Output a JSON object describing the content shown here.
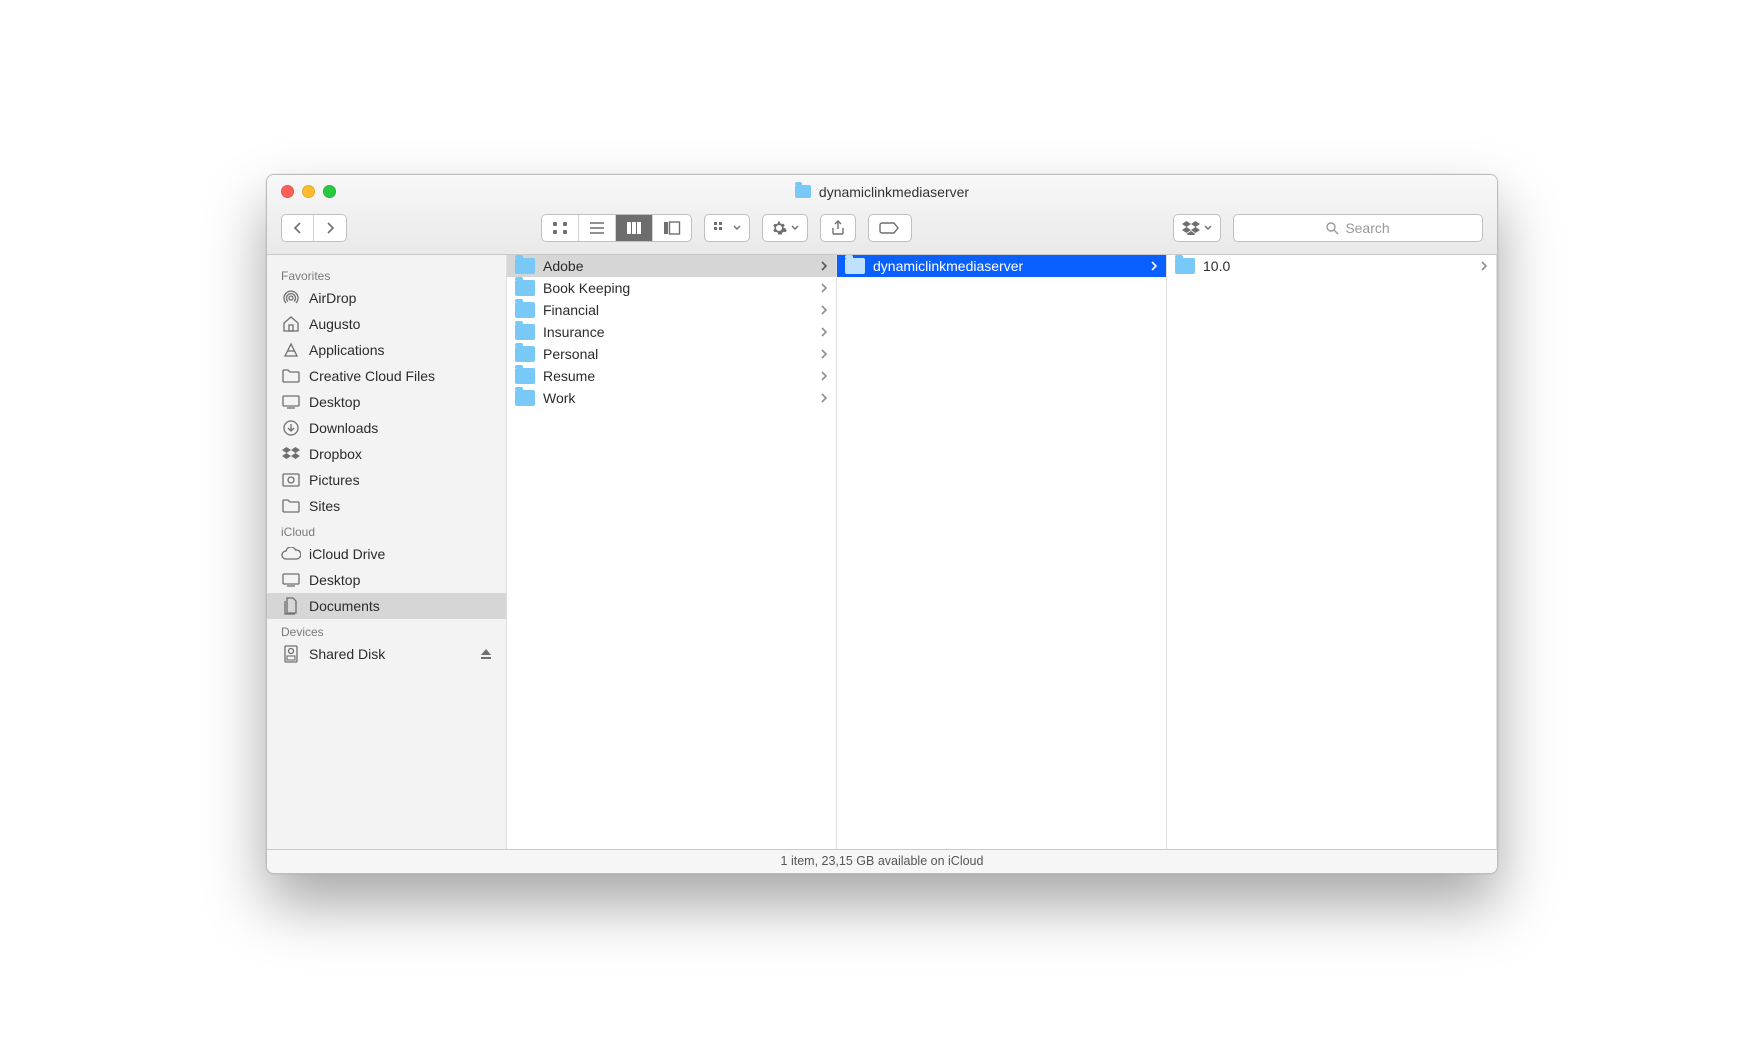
{
  "window_title": "dynamiclinkmediaserver",
  "search_placeholder": "Search",
  "status_bar": "1 item, 23,15 GB available on iCloud",
  "sidebar": {
    "groups": [
      {
        "title": "Favorites",
        "items": [
          {
            "icon": "airdrop",
            "label": "AirDrop"
          },
          {
            "icon": "home",
            "label": "Augusto"
          },
          {
            "icon": "app",
            "label": "Applications"
          },
          {
            "icon": "folder",
            "label": "Creative Cloud Files"
          },
          {
            "icon": "desktop",
            "label": "Desktop"
          },
          {
            "icon": "downloads",
            "label": "Downloads"
          },
          {
            "icon": "dropbox",
            "label": "Dropbox"
          },
          {
            "icon": "pictures",
            "label": "Pictures"
          },
          {
            "icon": "folder",
            "label": "Sites"
          }
        ]
      },
      {
        "title": "iCloud",
        "items": [
          {
            "icon": "icloud",
            "label": "iCloud Drive"
          },
          {
            "icon": "desktop",
            "label": "Desktop"
          },
          {
            "icon": "documents",
            "label": "Documents",
            "selected": true
          }
        ]
      },
      {
        "title": "Devices",
        "items": [
          {
            "icon": "disk",
            "label": "Shared Disk",
            "eject": true
          }
        ]
      }
    ]
  },
  "columns": [
    {
      "items": [
        {
          "label": "Adobe",
          "selected": "path"
        },
        {
          "label": "Book Keeping"
        },
        {
          "label": "Financial"
        },
        {
          "label": "Insurance"
        },
        {
          "label": "Personal"
        },
        {
          "label": "Resume"
        },
        {
          "label": "Work"
        }
      ]
    },
    {
      "items": [
        {
          "label": "dynamiclinkmediaserver",
          "selected": "highlight"
        }
      ]
    },
    {
      "items": [
        {
          "label": "10.0"
        }
      ]
    }
  ]
}
